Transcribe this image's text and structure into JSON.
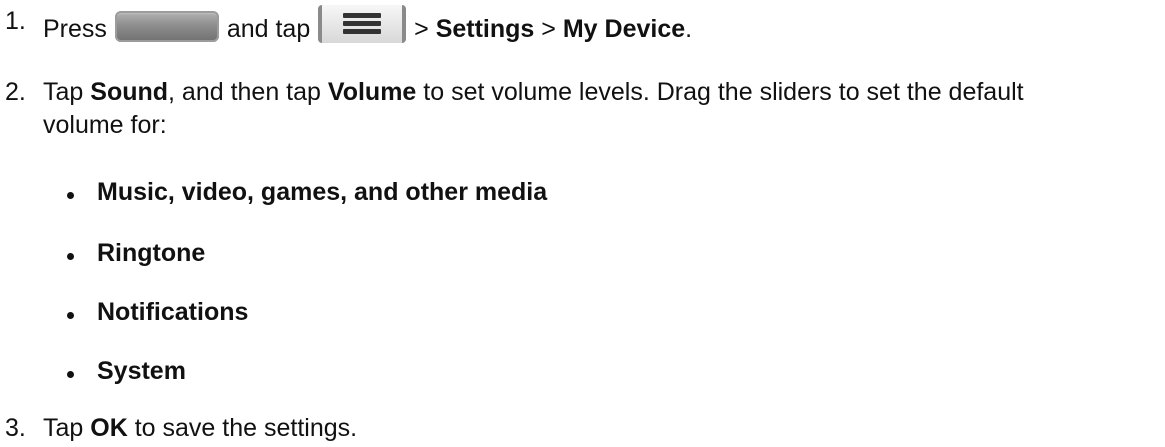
{
  "steps": [
    {
      "number": "1.",
      "press": "Press",
      "and_tap": "and tap",
      "sep1": ">",
      "settings": "Settings",
      "sep2": ">",
      "my_device": "My Device",
      "end": "."
    },
    {
      "number": "2.",
      "tap": "Tap",
      "sound": "Sound",
      "then_tap": ", and then tap",
      "volume": "Volume",
      "rest_line1": "to set volume levels. Drag the sliders to set the default",
      "rest_line2": "volume for:"
    },
    {
      "number": "3.",
      "tap": "Tap",
      "ok": "OK",
      "rest": "to save the settings."
    }
  ],
  "bullets": [
    "Music, video, games, and other media",
    "Ringtone",
    "Notifications",
    "System"
  ],
  "icons": {
    "home_button": "home-key-icon",
    "menu_button": "menu-key-icon"
  }
}
